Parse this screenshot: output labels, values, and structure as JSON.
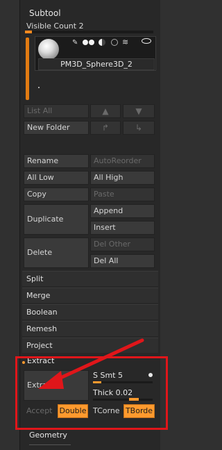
{
  "subtool": {
    "title": "Subtool",
    "visible_count_label": "Visible Count 2",
    "tool_name": "PM3D_Sphere3D_2",
    "visible_count_value": 2
  },
  "buttons": {
    "list_all": "List All",
    "new_folder": "New Folder",
    "rename": "Rename",
    "auto_reorder": "AutoReorder",
    "all_low": "All Low",
    "all_high": "All High",
    "copy": "Copy",
    "paste": "Paste",
    "duplicate": "Duplicate",
    "append": "Append",
    "insert": "Insert",
    "delete": "Delete",
    "del_other": "Del Other",
    "del_all": "Del All"
  },
  "sections": [
    "Split",
    "Merge",
    "Boolean",
    "Remesh",
    "Project"
  ],
  "extract": {
    "header": "Extract",
    "button": "Extract",
    "s_smt_label": "S Smt",
    "s_smt_value": "5",
    "thick_label": "Thick",
    "thick_value": "0.02",
    "accept": "Accept",
    "double": "Double",
    "tcorner": "TCorne",
    "tborder": "TBorde"
  },
  "geometry": "Geometry",
  "colors": {
    "accent": "#ff9a2e",
    "highlight_box": "#e0161a",
    "arrow": "#e0161a"
  }
}
